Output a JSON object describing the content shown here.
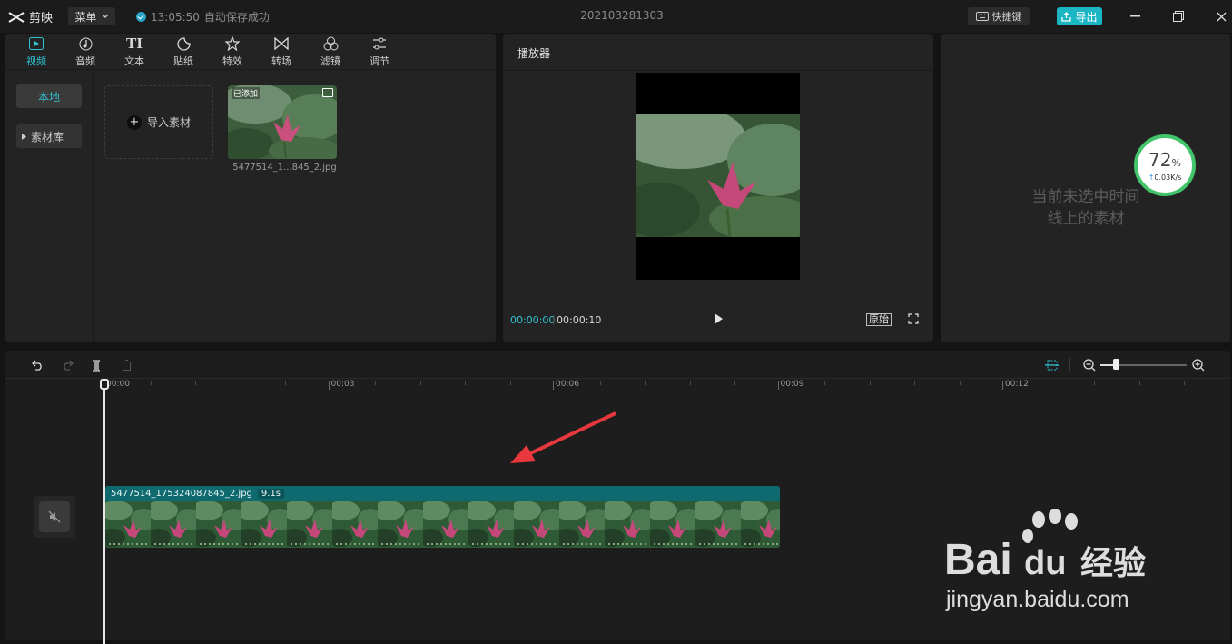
{
  "app": {
    "name": "剪映",
    "menu_label": "菜单",
    "save_time": "13:05:50",
    "save_text": "自动保存成功",
    "project_title": "202103281303",
    "shortcut_label": "快捷键",
    "export_label": "导出"
  },
  "media_tabs": [
    {
      "label": "视频",
      "icon": "video-icon",
      "active": true
    },
    {
      "label": "音频",
      "icon": "audio-icon"
    },
    {
      "label": "文本",
      "icon": "text-icon",
      "glyph": "TI"
    },
    {
      "label": "贴纸",
      "icon": "sticker-icon"
    },
    {
      "label": "特效",
      "icon": "effects-icon"
    },
    {
      "label": "转场",
      "icon": "transition-icon"
    },
    {
      "label": "滤镜",
      "icon": "filter-icon"
    },
    {
      "label": "调节",
      "icon": "adjust-icon"
    }
  ],
  "sidebar": {
    "local": "本地",
    "library": "素材库"
  },
  "media": {
    "import_label": "导入素材",
    "item_badge": "已添加",
    "item_name": "5477514_1...845_2.jpg"
  },
  "player": {
    "title": "播放器",
    "current_time": "00:00:00",
    "total_time": "00:00:10",
    "ratio_label": "原始"
  },
  "inspector": {
    "empty_line1": "当前未选中时间",
    "empty_line2": "线上的素材"
  },
  "speed_widget": {
    "percent": "72",
    "unit": "%",
    "rate": "0.03K/s",
    "color": "#41c46a"
  },
  "timeline": {
    "ruler_labels": [
      "00:00",
      "00:03",
      "00:06",
      "00:09",
      "00:12"
    ],
    "clip_name": "5477514_175324087845_2.jpg",
    "clip_duration": "9.1s"
  },
  "watermark": {
    "line1": "Bai",
    "line2": "du",
    "line3": "经验",
    "url": "jingyan.baidu.com"
  },
  "colors": {
    "accent": "#31c1d3",
    "export": "#1bb6c4",
    "clip": "#0f6d70",
    "arrow": "#e8383d"
  }
}
